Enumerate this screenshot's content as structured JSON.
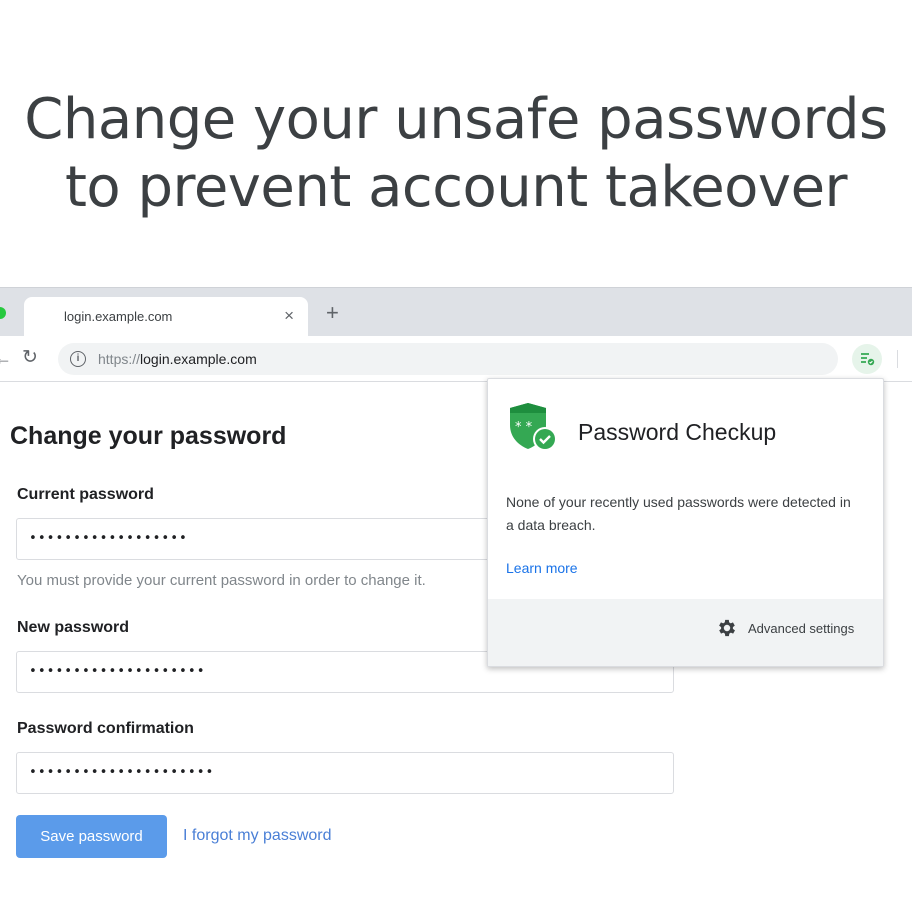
{
  "headline": {
    "line1": "Change your unsafe passwords",
    "line2": "to prevent account takeover"
  },
  "browser": {
    "tab_title": "login.example.com",
    "tab_close": "×",
    "new_tab": "+",
    "url_scheme": "https://",
    "url_host": "login.example.com",
    "icons": [
      "back-arrow-icon",
      "reload-icon",
      "info-icon",
      "password-checkup-extension-icon"
    ]
  },
  "page": {
    "title": "Change your password",
    "current_label": "Current password",
    "current_value": "••••••••••••••••••",
    "hint": "You must provide your current password in order to change it.",
    "new_label": "New password",
    "new_value": "••••••••••••••••••••",
    "confirm_label": "Password confirmation",
    "confirm_value": "•••••••••••••••••••••",
    "save_label": "Save password",
    "forgot_label": "I forgot my password"
  },
  "popup": {
    "title": "Password Checkup",
    "message": "None of your recently used passwords were detected in a data breach.",
    "learn_more": "Learn more",
    "advanced_settings": "Advanced settings"
  },
  "colors": {
    "accent_green": "#34a853",
    "button_blue": "#5b9bea",
    "link_blue": "#1a73e8"
  }
}
